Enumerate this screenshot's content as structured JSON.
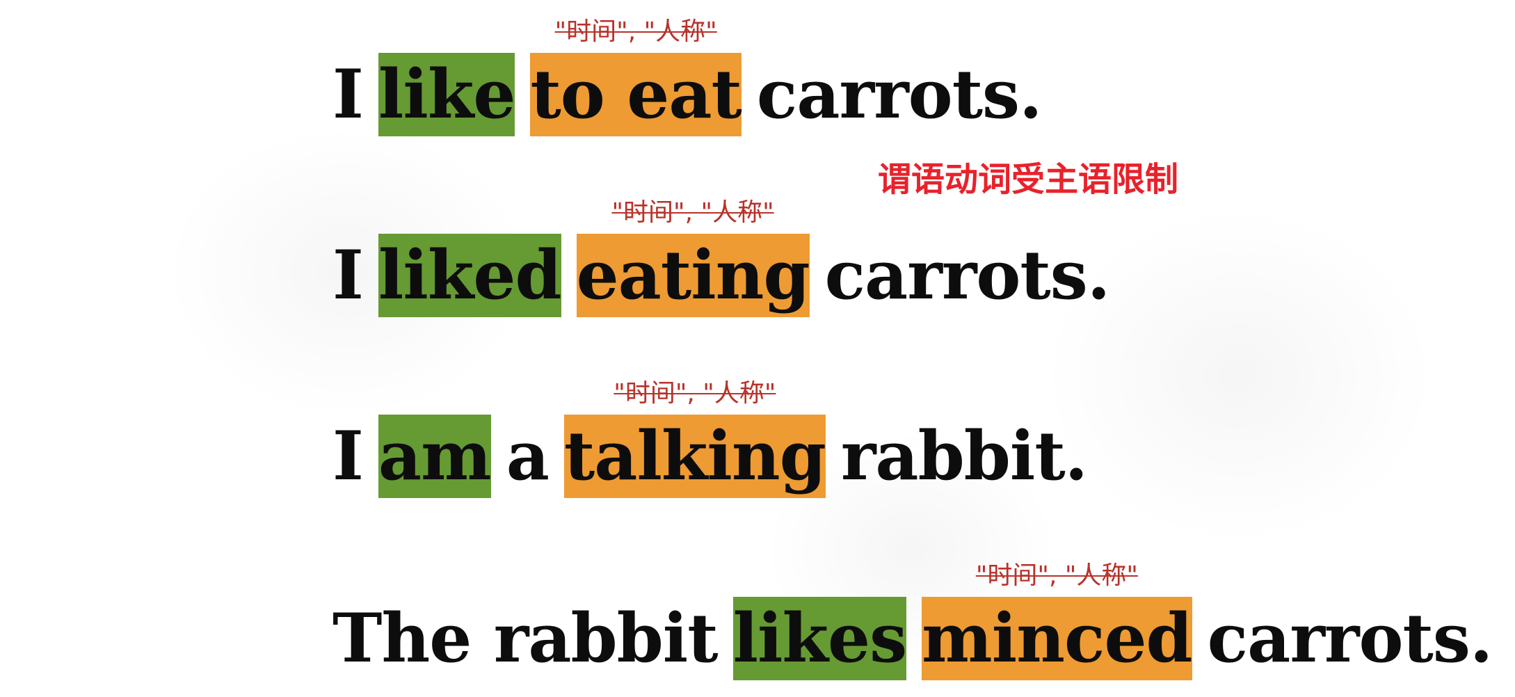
{
  "note": {
    "crossed_out": "\"时间\", \"人称\"",
    "rule": "谓语动词受主语限制"
  },
  "colors": {
    "predicate_verb": "#669a33",
    "non_finite_verb": "#ee9b33",
    "crossed_note": "#b8322a",
    "rule_note": "#e8222b",
    "text": "#0d0d0d"
  },
  "sentences": [
    {
      "pre": "I",
      "verb": "like",
      "mid": "",
      "nonfinite": "to eat",
      "post": "carrots."
    },
    {
      "pre": "I",
      "verb": "liked",
      "mid": "",
      "nonfinite": "eating",
      "post": "carrots."
    },
    {
      "pre": "I",
      "verb": "am",
      "mid": "a",
      "nonfinite": "talking",
      "post": "rabbit."
    },
    {
      "pre": "The rabbit",
      "verb": "likes",
      "mid": "",
      "nonfinite": "minced",
      "post": "carrots."
    }
  ]
}
